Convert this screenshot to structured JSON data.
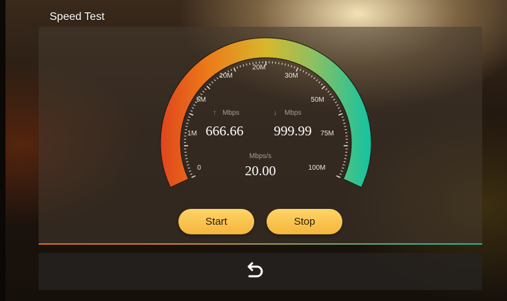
{
  "app": {
    "title": "Speed Test"
  },
  "gauge": {
    "scale_labels": [
      "0",
      "1M",
      "5M",
      "10M",
      "20M",
      "30M",
      "50M",
      "75M",
      "100M"
    ],
    "upload": {
      "arrow": "↑",
      "unit": "Mbps",
      "value": "666.66"
    },
    "download": {
      "arrow": "↓",
      "unit": "Mbps",
      "value": "999.99"
    },
    "rate": {
      "unit": "Mbps/s",
      "value": "20.00"
    },
    "colors": {
      "start": "#e0471c",
      "mid": "#d7b82c",
      "end": "#14c3a1"
    }
  },
  "buttons": {
    "start": "Start",
    "stop": "Stop"
  },
  "footer": {
    "back_icon": "back-arrow-icon"
  }
}
